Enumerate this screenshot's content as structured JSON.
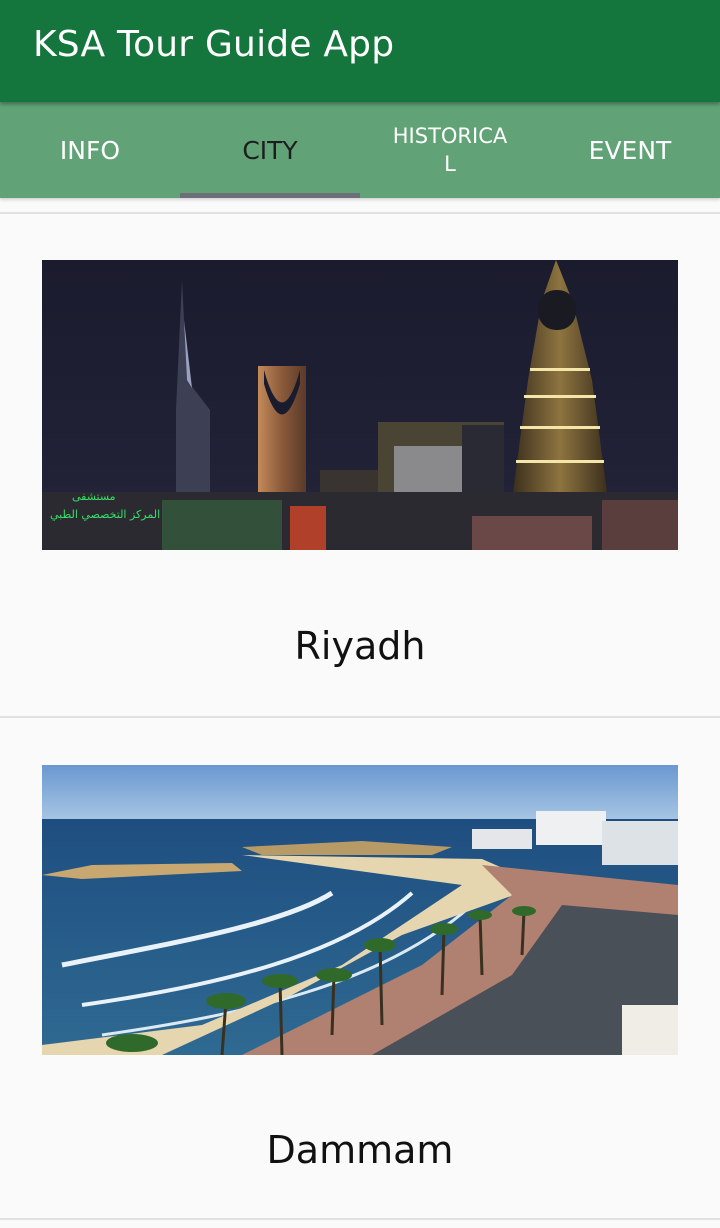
{
  "app": {
    "title": "KSA Tour Guide App"
  },
  "tabs": [
    {
      "label": "INFO",
      "active": false
    },
    {
      "label": "CITY",
      "active": true
    },
    {
      "label": "HISTORICAL",
      "active": false
    },
    {
      "label": "EVENT",
      "active": false
    }
  ],
  "cities": [
    {
      "name": "Riyadh",
      "image": "riyadh-skyline-night-photo"
    },
    {
      "name": "Dammam",
      "image": "dammam-coastline-photo"
    }
  ],
  "photo_signs": {
    "riyadh_sign_line1": "مستشفى",
    "riyadh_sign_line2": "المركز التخصصي الطبي"
  },
  "colors": {
    "appbar": "#14763c",
    "tabbar": "#61a377",
    "indicator": "#6c6e7a",
    "background": "#fafafa"
  }
}
